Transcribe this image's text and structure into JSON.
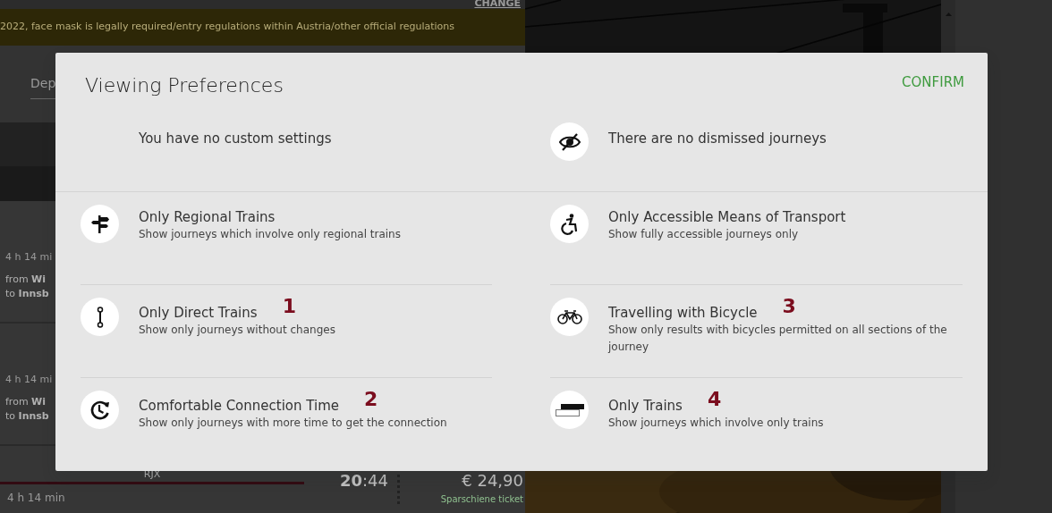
{
  "background": {
    "change_link": "CHANGE",
    "notice": "2022, face mask is legally required/entry regulations within Austria/other official regulations",
    "departure_field": {
      "label": "Dep"
    },
    "journeys": [
      {
        "duration": "4 h 14 mi",
        "from": "from **Wi**",
        "to": "to **Innsb**"
      },
      {
        "duration": "4 h 14 mi",
        "from": "from **Wi**",
        "to": "to **Innsb**"
      }
    ],
    "last_journey": {
      "train": "RJX",
      "arrival": "**20**:44",
      "price": "€ 24,90",
      "fare": "Sparschiene ticket",
      "duration": "4 h 14 min"
    }
  },
  "dialog": {
    "title": "Viewing Preferences",
    "confirm": "CONFIRM",
    "summary": [
      {
        "text": "You have no custom settings"
      },
      {
        "text": "There are no dismissed journeys",
        "kind": "dismissed"
      }
    ],
    "columns": [
      [
        {
          "kind": "regional",
          "title": "Only Regional Trains",
          "description": "Show journeys which involve only regional trains"
        },
        {
          "kind": "direct",
          "title": "Only Direct Trains",
          "description": "Show only journeys without changes",
          "annotation": "1"
        },
        {
          "kind": "connection",
          "title": "Comfortable Connection Time",
          "description": "Show only journeys with more time to get the connection",
          "annotation": "2"
        }
      ],
      [
        {
          "kind": "accessible",
          "title": "Only Accessible Means of Transport",
          "description": "Show fully accessible journeys only"
        },
        {
          "kind": "bicycle",
          "title": "Travelling with Bicycle",
          "description": "Show only results with bicycles permitted on all sections of the journey",
          "annotation": "3"
        },
        {
          "kind": "trains",
          "title": "Only Trains",
          "description": "Show journeys which involve only trains",
          "annotation": "4"
        }
      ]
    ]
  }
}
